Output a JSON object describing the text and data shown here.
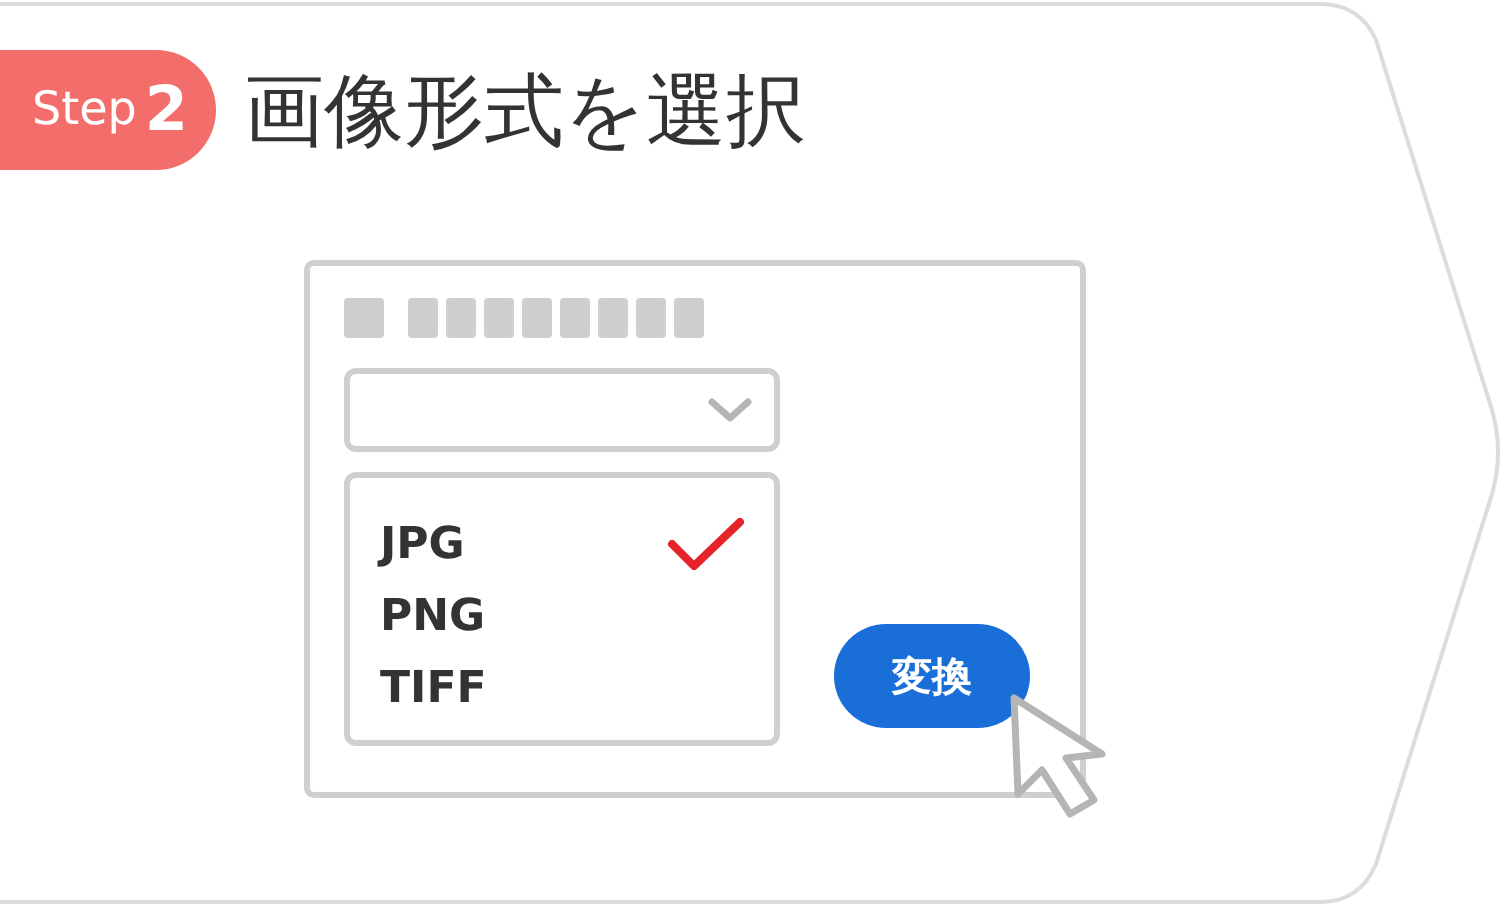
{
  "step_badge": {
    "label": "Step",
    "number": "2"
  },
  "title": "画像形式を選択",
  "format_list": [
    {
      "label": "JPG",
      "selected": true
    },
    {
      "label": "PNG",
      "selected": false
    },
    {
      "label": "TIFF",
      "selected": false
    }
  ],
  "convert_button": {
    "label": "変換"
  }
}
